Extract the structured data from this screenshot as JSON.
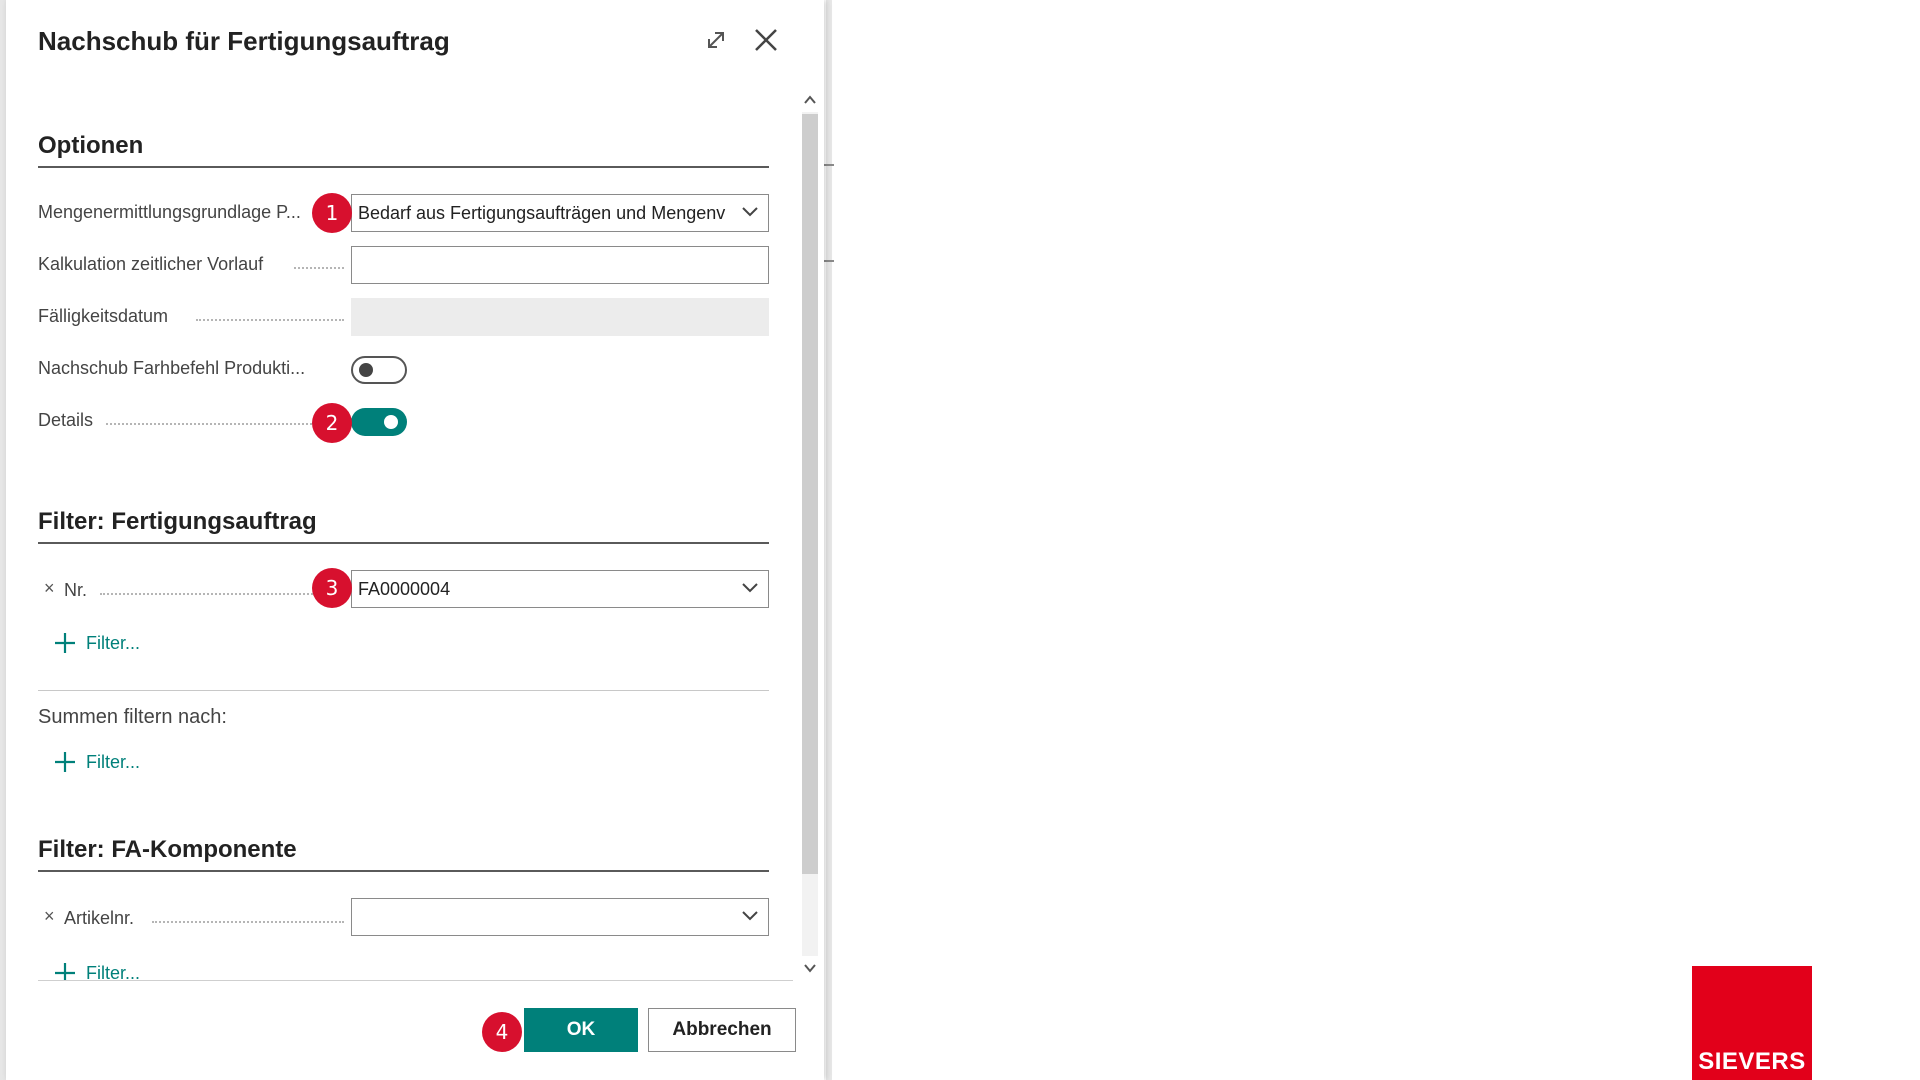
{
  "dialog": {
    "title": "Nachschub für Fertigungsauftrag"
  },
  "optionen": {
    "heading": "Optionen",
    "fields": [
      {
        "label": "Mengenermittlungsgrundlage P...",
        "value": "Bedarf aus Fertigungsaufträgen und Mengenv"
      },
      {
        "label": "Kalkulation zeitlicher Vorlauf",
        "value": ""
      },
      {
        "label": "Fälligkeitsdatum",
        "value": ""
      },
      {
        "label": "Nachschub Farhbefehl Produkti...",
        "toggle": false
      },
      {
        "label": "Details",
        "toggle": true
      }
    ]
  },
  "filter_fa": {
    "heading": "Filter: Fertigungsauftrag",
    "nr_label": "Nr.",
    "nr_value": "FA0000004",
    "add_filter": "Filter...",
    "sums_label": "Summen filtern nach:",
    "sums_add_filter": "Filter..."
  },
  "filter_komp": {
    "heading": "Filter: FA-Komponente",
    "artikel_label": "Artikelnr.",
    "artikel_value": "",
    "add_filter": "Filter..."
  },
  "badges": [
    "1",
    "2",
    "3",
    "4"
  ],
  "buttons": {
    "ok": "OK",
    "cancel": "Abbrechen"
  },
  "brand": {
    "name": "SIEVERS",
    "color": "#e2001a"
  },
  "colors": {
    "accent": "#00807a",
    "badge": "#d7102e"
  },
  "icons": {
    "expand": "expand-icon",
    "close": "close-icon",
    "chevron": "chevron-down-icon",
    "plus": "plus-icon",
    "remove": "remove-filter-icon"
  }
}
